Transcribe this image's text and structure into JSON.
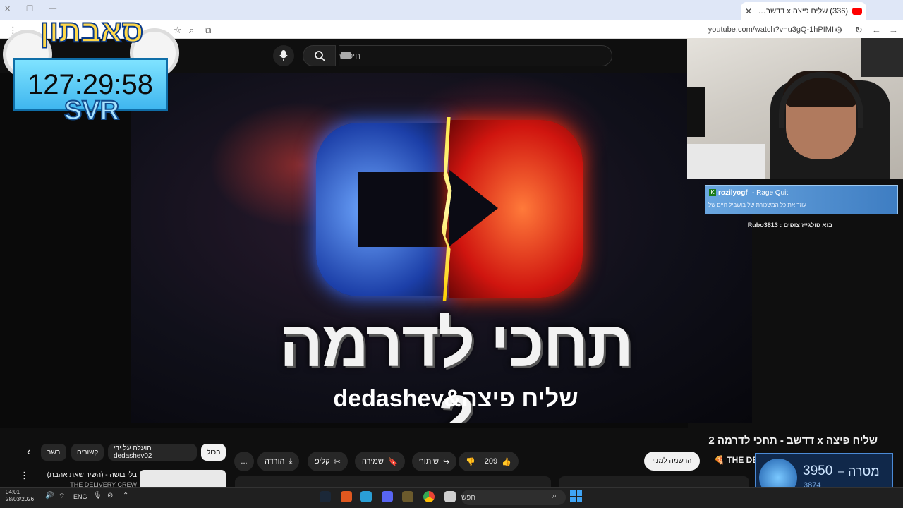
{
  "browser": {
    "tab_title": "(336) שליח פיצה x דדשב - תחכי",
    "url": "youtube.com/watch?v=u3gQ-1hPIMI"
  },
  "youtube": {
    "search_placeholder": "חיפוש",
    "video_title": "שליח פיצה x דדשב - תחכי לדרמה 2",
    "thumbnail": {
      "title_text": "תחכי לדרמה 2",
      "subtitle_text": "שליח פיצה&dedashev"
    },
    "channel_name": "THE DEL",
    "subscribe_label": "הרשמה למנוי",
    "actions": {
      "like_count": "209",
      "share_label": "שיתוף",
      "save_label": "שמירה",
      "clip_label": "קליפ",
      "download_label": "הורדה",
      "more": "..."
    },
    "chips": [
      "הכול",
      "הועלה על ידי dedashev02",
      "קשורים",
      "בשב"
    ],
    "related": {
      "title": "בלי בושה - (השיר שאת אהבת)",
      "channel": "THE DELIVERY CREW"
    }
  },
  "overlay": {
    "brand": "סאבתון",
    "timer": "127:29:58",
    "timer_caption": "SVR",
    "alert_user": "rozilyogf",
    "alert_tag": "- Rage Quit",
    "alert_message": "עוזר את כל המשכורת של בושביל חיים של",
    "chat_line": "בוא פולגייז צופים : Rubo3813",
    "goal_label": "מטרה",
    "goal_value": "3950",
    "goal_current": "3874"
  },
  "taskbar": {
    "search_label": "חפש",
    "language": "ENG",
    "time": "04:01",
    "date": "28/03/2026"
  },
  "colors": {
    "youtube_bg": "#0f0f0f",
    "accent_red": "#ff0000",
    "timer_bg": "#3fb6ef"
  }
}
